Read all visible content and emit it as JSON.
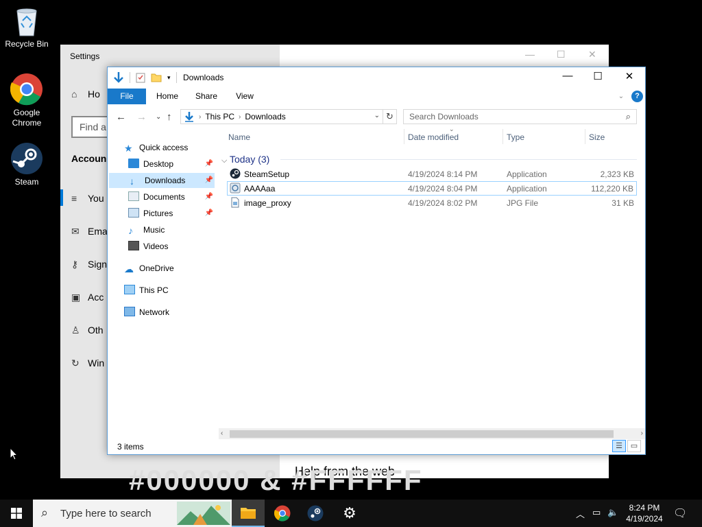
{
  "desktop": {
    "icons": [
      {
        "label": "Recycle Bin"
      },
      {
        "label": "Google Chrome"
      },
      {
        "label": "Steam"
      }
    ]
  },
  "settings": {
    "title": "Settings",
    "home_label": "Ho",
    "find_placeholder": "Find a",
    "section_title": "Accoun",
    "items": [
      "You",
      "Ema",
      "Sign",
      "Acc",
      "Oth",
      "Win"
    ],
    "help_text": "Help from the web",
    "background_text": "#000000 & #FFFFFF"
  },
  "explorer": {
    "title": "Downloads",
    "ribbon_tabs": [
      "File",
      "Home",
      "Share",
      "View"
    ],
    "breadcrumb": [
      "This PC",
      "Downloads"
    ],
    "search_placeholder": "Search Downloads",
    "nav": {
      "quick_access": "Quick access",
      "desktop": "Desktop",
      "downloads": "Downloads",
      "documents": "Documents",
      "pictures": "Pictures",
      "music": "Music",
      "videos": "Videos",
      "onedrive": "OneDrive",
      "this_pc": "This PC",
      "network": "Network"
    },
    "columns": {
      "name": "Name",
      "date": "Date modified",
      "type": "Type",
      "size": "Size"
    },
    "group_label": "Today (3)",
    "files": [
      {
        "name": "SteamSetup",
        "date": "4/19/2024 8:14 PM",
        "type": "Application",
        "size": "2,323 KB",
        "icon": "steam-app-icon"
      },
      {
        "name": "AAAAaa",
        "date": "4/19/2024 8:04 PM",
        "type": "Application",
        "size": "112,220 KB",
        "icon": "setup-app-icon"
      },
      {
        "name": "image_proxy",
        "date": "4/19/2024 8:02 PM",
        "type": "JPG File",
        "size": "31 KB",
        "icon": "jpg-file-icon"
      }
    ],
    "status": "3 items"
  },
  "taskbar": {
    "search_placeholder": "Type here to search",
    "time": "8:24 PM",
    "date": "4/19/2024"
  },
  "colors": {
    "accent": "#0078d7",
    "ribbon_file": "#1979ca",
    "selection": "#cce8ff"
  }
}
